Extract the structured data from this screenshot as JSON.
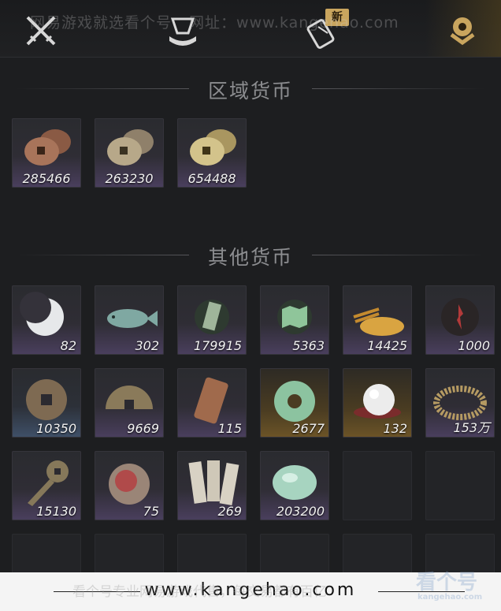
{
  "watermark": {
    "top_text": "网易游戏就选看个号",
    "top_url_label": "网址：",
    "top_url": "www.kangehao.com",
    "bottom_text": "看个号专业网易游戏代售，每交易都有百亿",
    "logo_text": "看个号",
    "logo_sub": "kangehao.com"
  },
  "footer": {
    "url": "www.kangehao.com"
  },
  "tabs": [
    {
      "name": "tab-equipment",
      "icon": "crossed-swords-icon"
    },
    {
      "name": "tab-gear",
      "icon": "bundle-icon"
    },
    {
      "name": "tab-scrolls",
      "icon": "scroll-icon",
      "badge": "新"
    },
    {
      "name": "tab-currency",
      "icon": "currency-icon",
      "active": true
    }
  ],
  "sections": {
    "regional": "区域货币",
    "other": "其他货币"
  },
  "regional_items": [
    {
      "icon": "copper-coins-icon",
      "count": "285466"
    },
    {
      "icon": "silver-coins-icon",
      "count": "263230"
    },
    {
      "icon": "gold-coins-icon",
      "count": "654488"
    }
  ],
  "other_items": [
    {
      "icon": "crescent-moon-icon",
      "count": "82"
    },
    {
      "icon": "jade-fish-icon",
      "count": "302"
    },
    {
      "icon": "jade-token-icon",
      "count": "179915"
    },
    {
      "icon": "map-icon",
      "count": "5363"
    },
    {
      "icon": "grain-pile-icon",
      "count": "14425"
    },
    {
      "icon": "red-seal-icon",
      "count": "1000"
    },
    {
      "icon": "bronze-coin-icon",
      "count": "10350"
    },
    {
      "icon": "half-coin-icon",
      "count": "9669"
    },
    {
      "icon": "copper-plaque-icon",
      "count": "115"
    },
    {
      "icon": "jade-ring-icon",
      "count": "2677"
    },
    {
      "icon": "pearl-icon",
      "count": "132"
    },
    {
      "icon": "coin-string-icon",
      "count": "153万"
    },
    {
      "icon": "key-coin-icon",
      "count": "15130"
    },
    {
      "icon": "red-stone-icon",
      "count": "75"
    },
    {
      "icon": "paper-notes-icon",
      "count": "269"
    },
    {
      "icon": "jade-stone-icon",
      "count": "203200"
    }
  ],
  "colors": {
    "background": "#1d1e20",
    "slot_purple": "#4a3f5e",
    "slot_gold": "#6c5427",
    "slot_blue": "#3f5068",
    "active_tab": "#c9a55e"
  }
}
